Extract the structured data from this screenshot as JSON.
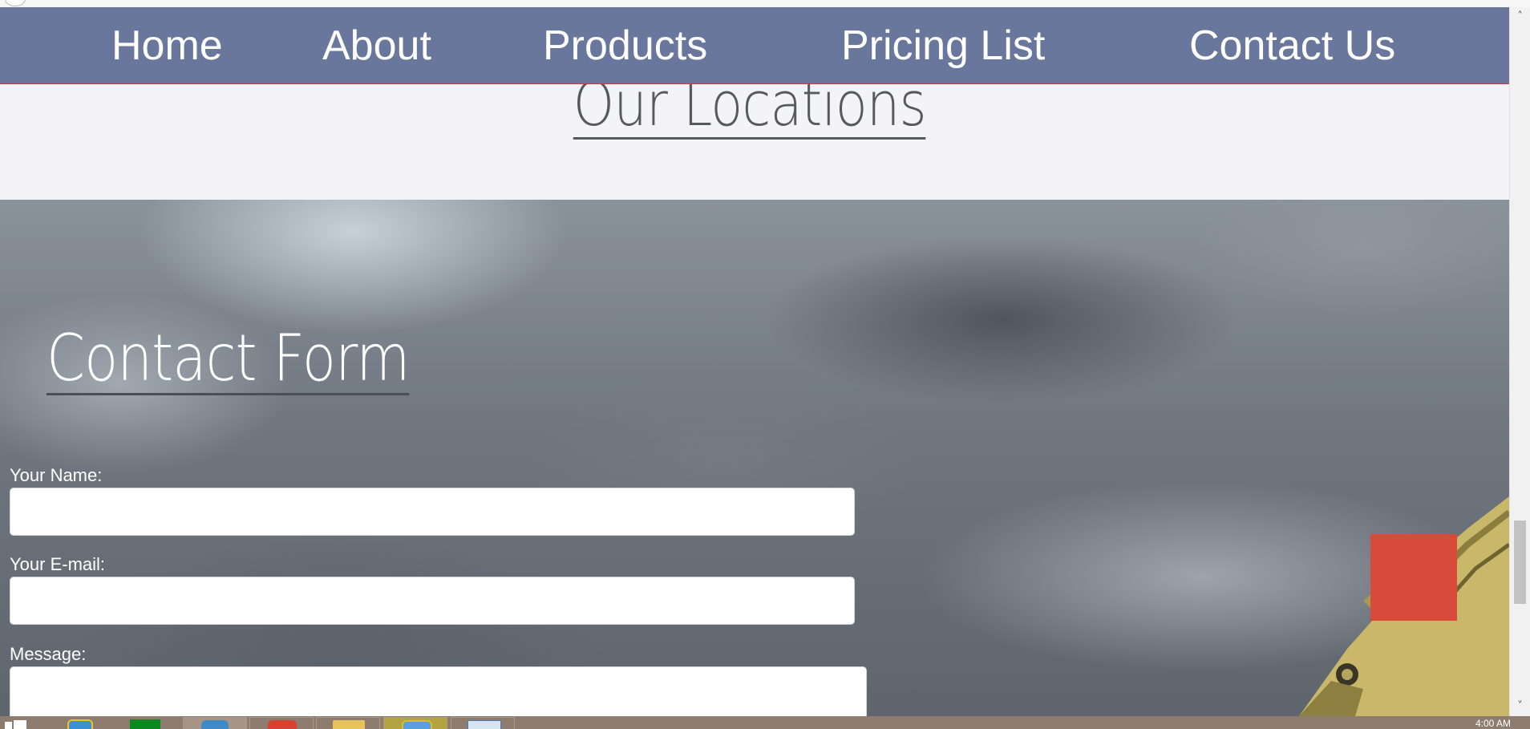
{
  "nav": {
    "items": [
      {
        "label": "Home"
      },
      {
        "label": "About"
      },
      {
        "label": "Products"
      },
      {
        "label": "Pricing List"
      },
      {
        "label": "Contact Us"
      }
    ]
  },
  "locations": {
    "title": "Our Locations"
  },
  "contact": {
    "title": "Contact Form",
    "name_label": "Your Name:",
    "email_label": "Your E-mail:",
    "message_label": "Message:"
  },
  "taskbar": {
    "apps": [
      "start-icon",
      "internet-explorer-icon",
      "store-icon",
      "browser-icon",
      "chrome-icon",
      "file-explorer-icon",
      "ie-globe-icon",
      "window-icon"
    ],
    "clock": "4:00 AM"
  },
  "colors": {
    "navbar": "#68779b",
    "accent_square": "#d84b3b",
    "page_bg": "#f4f4f6",
    "taskbar": "#8e7d6e"
  }
}
